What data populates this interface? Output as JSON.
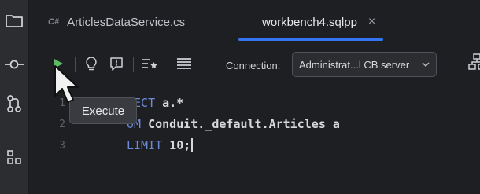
{
  "tabs": [
    {
      "icon_text": "C#",
      "label": "ArticlesDataService.cs",
      "active": false
    },
    {
      "label": "workbench4.sqlpp",
      "close_glyph": "×",
      "active": true
    }
  ],
  "activity_bar": {
    "icons": [
      "folder-icon",
      "commit-icon",
      "pull-request-icon",
      "structure-icon"
    ]
  },
  "toolbar": {
    "buttons": [
      "execute-icon",
      "lightbulb-icon",
      "explain-icon",
      "favorites-icon",
      "menu-icon"
    ],
    "connection_label": "Connection:",
    "connection_value": "Administrat...l CB server"
  },
  "editor": {
    "line_numbers": [
      "1",
      "2",
      "3"
    ],
    "lines": [
      {
        "kw": "LECT",
        "rest": " a.*"
      },
      {
        "kw": "OM",
        "rest": " Conduit._default.Articles a"
      },
      {
        "kw": "LIMIT",
        "rest": " 10;"
      }
    ]
  },
  "tooltip": {
    "text": "Execute"
  },
  "colors": {
    "accent": "#3574f0",
    "run_green": "#5fb865",
    "keyword": "#6c8bd6"
  }
}
